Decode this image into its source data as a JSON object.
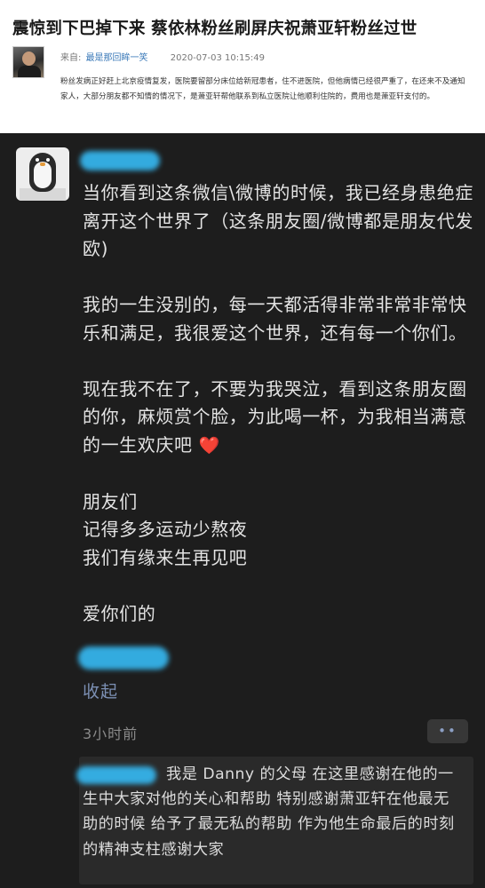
{
  "article": {
    "title": "震惊到下巴掉下来 蔡依林粉丝刷屏庆祝萧亚轩粉丝过世",
    "source_prefix": "来自:",
    "author": "最是那回眸一笑",
    "date": "2020-07-03 10:15:49",
    "summary": "粉丝发病正好赶上北京疫情复发，医院要留部分床位给新冠患者，住不进医院，但他病情已经很严重了，在还来不及通知家人，大部分朋友都不知情的情况下，是萧亚轩帮他联系到私立医院让他顺利住院的，费用也是萧亚轩支付的。"
  },
  "post": {
    "paragraphs": [
      "当你看到这条微信\\微博的时候，我已经身患绝症离开这个世界了（这条朋友圈/微博都是朋友代发欧)",
      "我的一生没别的，每一天都活得非常非常非常快乐和满足，我很爱这个世界，还有每一个你们。",
      "现在我不在了，不要为我哭泣，看到这条朋友圈的你，麻烦赏个脸，为此喝一杯，为我相当满意的一生欢庆吧"
    ],
    "heart": "❤️",
    "friends_lines": [
      "朋友们",
      "记得多多运动少熬夜",
      "我们有缘来生再见吧"
    ],
    "closing": "爱你们的",
    "collapse_label": "收起",
    "time": "3小时前",
    "more_label": "••"
  },
  "comment": {
    "text": "我是 Danny 的父母 在这里感谢在他的一生中大家对他的关心和帮助 特别感谢萧亚轩在他最无助的时候 给予了最无私的帮助 作为他生命最后的时刻的精神支柱感谢大家"
  },
  "colors": {
    "panel_bg": "#1d1d1d",
    "link_blue": "#7c90b4",
    "redaction": "#35b3ea",
    "author_link": "#3a79b8"
  },
  "icons": {
    "avatar": "penguin-avatar",
    "author_avatar": "person-avatar",
    "heart": "red-heart-emoji",
    "more": "two-dots-more-icon"
  }
}
